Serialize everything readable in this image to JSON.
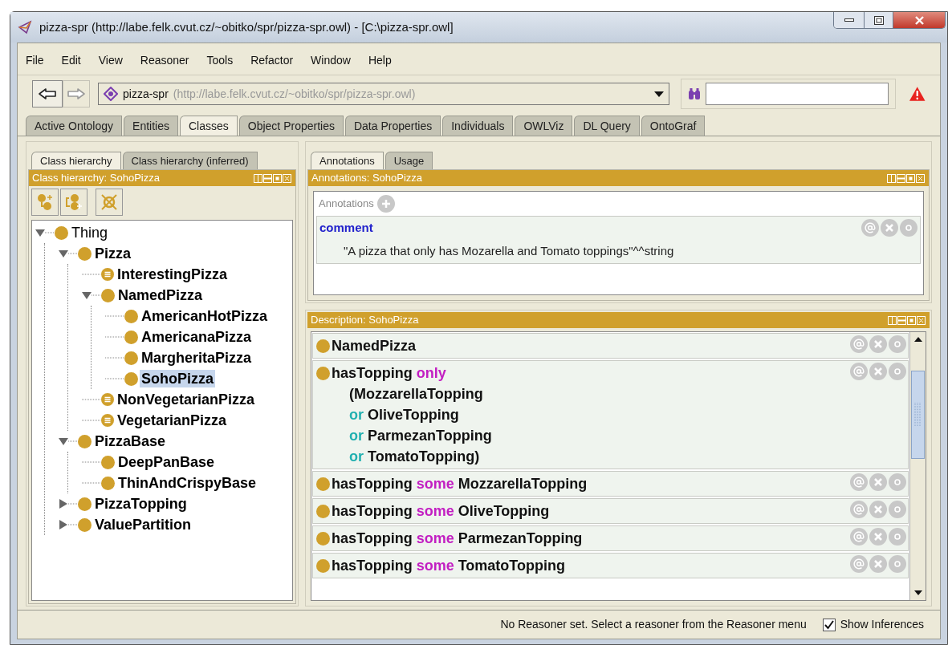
{
  "window": {
    "title": "pizza-spr (http://labe.felk.cvut.cz/~obitko/spr/pizza-spr.owl) - [C:\\pizza-spr.owl]"
  },
  "menu": [
    "File",
    "Edit",
    "View",
    "Reasoner",
    "Tools",
    "Refactor",
    "Window",
    "Help"
  ],
  "navigation": {
    "ontology_name": "pizza-spr",
    "ontology_iri": "(http://labe.felk.cvut.cz/~obitko/spr/pizza-spr.owl)"
  },
  "tabs": [
    {
      "label": "Active Ontology",
      "selected": false
    },
    {
      "label": "Entities",
      "selected": false
    },
    {
      "label": "Classes",
      "selected": true
    },
    {
      "label": "Object Properties",
      "selected": false
    },
    {
      "label": "Data Properties",
      "selected": false
    },
    {
      "label": "Individuals",
      "selected": false
    },
    {
      "label": "OWLViz",
      "selected": false
    },
    {
      "label": "DL Query",
      "selected": false
    },
    {
      "label": "OntoGraf",
      "selected": false
    }
  ],
  "class_panel": {
    "tabs": [
      {
        "label": "Class hierarchy",
        "selected": true
      },
      {
        "label": "Class hierarchy (inferred)",
        "selected": false
      }
    ],
    "title": "Class hierarchy: SohoPizza",
    "tree": [
      {
        "label": "Thing",
        "kind": "root",
        "expanded": true,
        "selected": false,
        "children": [
          {
            "label": "Pizza",
            "kind": "primitive",
            "expanded": true,
            "selected": false,
            "children": [
              {
                "label": "InterestingPizza",
                "kind": "defined",
                "selected": false
              },
              {
                "label": "NamedPizza",
                "kind": "primitive",
                "expanded": true,
                "selected": false,
                "children": [
                  {
                    "label": "AmericanHotPizza",
                    "kind": "primitive",
                    "selected": false
                  },
                  {
                    "label": "AmericanaPizza",
                    "kind": "primitive",
                    "selected": false
                  },
                  {
                    "label": "MargheritaPizza",
                    "kind": "primitive",
                    "selected": false
                  },
                  {
                    "label": "SohoPizza",
                    "kind": "primitive",
                    "selected": true
                  }
                ]
              },
              {
                "label": "NonVegetarianPizza",
                "kind": "defined",
                "selected": false
              },
              {
                "label": "VegetarianPizza",
                "kind": "defined",
                "selected": false
              }
            ]
          },
          {
            "label": "PizzaBase",
            "kind": "primitive",
            "expanded": true,
            "selected": false,
            "children": [
              {
                "label": "DeepPanBase",
                "kind": "primitive",
                "selected": false
              },
              {
                "label": "ThinAndCrispyBase",
                "kind": "primitive",
                "selected": false
              }
            ]
          },
          {
            "label": "PizzaTopping",
            "kind": "primitive",
            "expanded": false,
            "selected": false
          },
          {
            "label": "ValuePartition",
            "kind": "primitive",
            "expanded": false,
            "selected": false
          }
        ]
      }
    ]
  },
  "annotations_panel": {
    "tabs": [
      {
        "label": "Annotations",
        "selected": true
      },
      {
        "label": "Usage",
        "selected": false
      }
    ],
    "title": "Annotations: SohoPizza",
    "section_label": "Annotations",
    "items": [
      {
        "property": "comment",
        "value": "\"A pizza that only has Mozarella and Tomato toppings\"^^string"
      }
    ]
  },
  "description_panel": {
    "title": "Description: SohoPizza",
    "rows": [
      {
        "lines": [
          [
            {
              "text": "NamedPizza",
              "kind": "plain"
            }
          ]
        ]
      },
      {
        "lines": [
          [
            {
              "text": "hasTopping",
              "kind": "plain"
            },
            {
              "text": "only",
              "kind": "keyword"
            }
          ],
          [
            {
              "text": "(MozzarellaTopping",
              "kind": "plain"
            }
          ],
          [
            {
              "text": "or",
              "kind": "connective"
            },
            {
              "text": "OliveTopping",
              "kind": "plain"
            }
          ],
          [
            {
              "text": "or",
              "kind": "connective"
            },
            {
              "text": "ParmezanTopping",
              "kind": "plain"
            }
          ],
          [
            {
              "text": "or",
              "kind": "connective"
            },
            {
              "text": "TomatoTopping)",
              "kind": "plain"
            }
          ]
        ]
      },
      {
        "lines": [
          [
            {
              "text": "hasTopping",
              "kind": "plain"
            },
            {
              "text": "some",
              "kind": "keyword"
            },
            {
              "text": "MozzarellaTopping",
              "kind": "plain"
            }
          ]
        ]
      },
      {
        "lines": [
          [
            {
              "text": "hasTopping",
              "kind": "plain"
            },
            {
              "text": "some",
              "kind": "keyword"
            },
            {
              "text": "OliveTopping",
              "kind": "plain"
            }
          ]
        ]
      },
      {
        "lines": [
          [
            {
              "text": "hasTopping",
              "kind": "plain"
            },
            {
              "text": "some",
              "kind": "keyword"
            },
            {
              "text": "ParmezanTopping",
              "kind": "plain"
            }
          ]
        ]
      },
      {
        "lines": [
          [
            {
              "text": "hasTopping",
              "kind": "plain"
            },
            {
              "text": "some",
              "kind": "keyword"
            },
            {
              "text": "TomatoTopping",
              "kind": "plain"
            }
          ]
        ]
      }
    ]
  },
  "status_bar": {
    "message": "No Reasoner set. Select a reasoner from the Reasoner menu",
    "show_inferences": {
      "label": "Show Inferences",
      "checked": true
    }
  }
}
